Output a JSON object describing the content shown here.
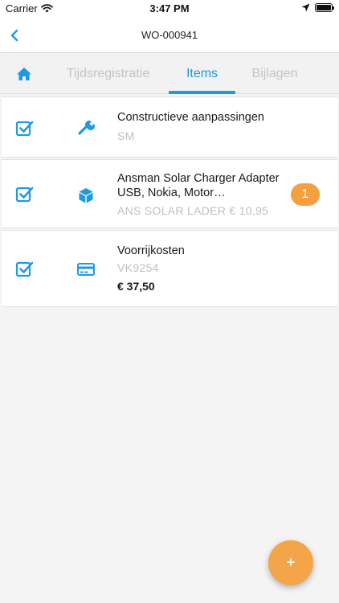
{
  "status_bar": {
    "carrier": "Carrier",
    "time": "3:47 PM"
  },
  "nav": {
    "title": "WO-000941",
    "back_icon": "chevron-left-icon"
  },
  "tabs": [
    {
      "icon": "home-icon"
    },
    {
      "label": "Tijdsregistratie"
    },
    {
      "label": "Items",
      "active": true
    },
    {
      "label": "Bijlagen"
    }
  ],
  "items": [
    {
      "title": "Constructieve aanpassingen",
      "subtitle": "SM",
      "icon": "wrench-icon",
      "checked": true
    },
    {
      "title": "Ansman Solar Charger Adapter USB, Nokia, Motor…",
      "subtitle": "ANS SOLAR LADER € 10,95",
      "icon": "box-icon",
      "checked": true,
      "quantity": "1"
    },
    {
      "title": "Voorrijkosten",
      "subtitle": "VK9254",
      "price": "€ 37,50",
      "icon": "credit-card-icon",
      "checked": true
    }
  ],
  "fab": {
    "label": "+"
  },
  "colors": {
    "accent": "#1e9ae0",
    "orange": "#f4a041",
    "background": "#f4f4f4"
  }
}
